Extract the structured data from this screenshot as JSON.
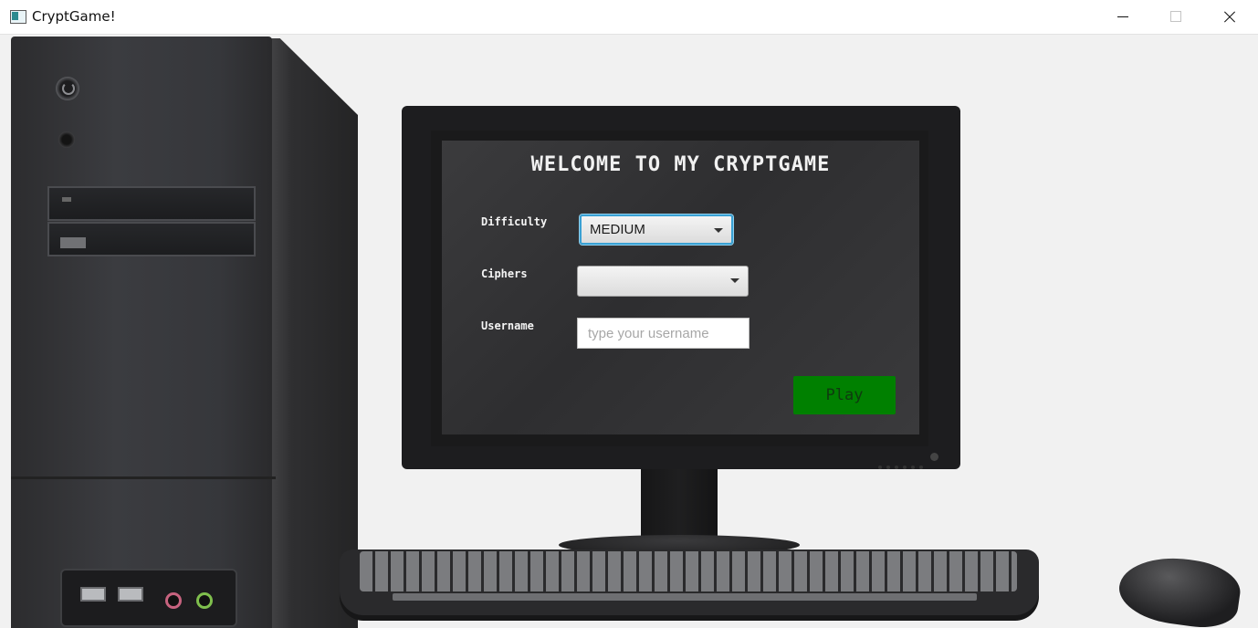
{
  "window": {
    "title": "CryptGame!",
    "controls": {
      "minimize_icon": "minimize-icon",
      "maximize_icon": "maximize-icon",
      "close_icon": "close-icon"
    }
  },
  "form": {
    "heading": "WELCOME TO MY CRYPTGAME",
    "difficulty": {
      "label": "Difficulty",
      "value": "MEDIUM"
    },
    "ciphers": {
      "label": "Ciphers",
      "value": ""
    },
    "username": {
      "label": "Username",
      "value": "",
      "placeholder": "type your username"
    },
    "play_label": "Play"
  },
  "colors": {
    "play_button": "#008000",
    "focus_ring": "#3aa1d4",
    "screen": "#333335"
  }
}
